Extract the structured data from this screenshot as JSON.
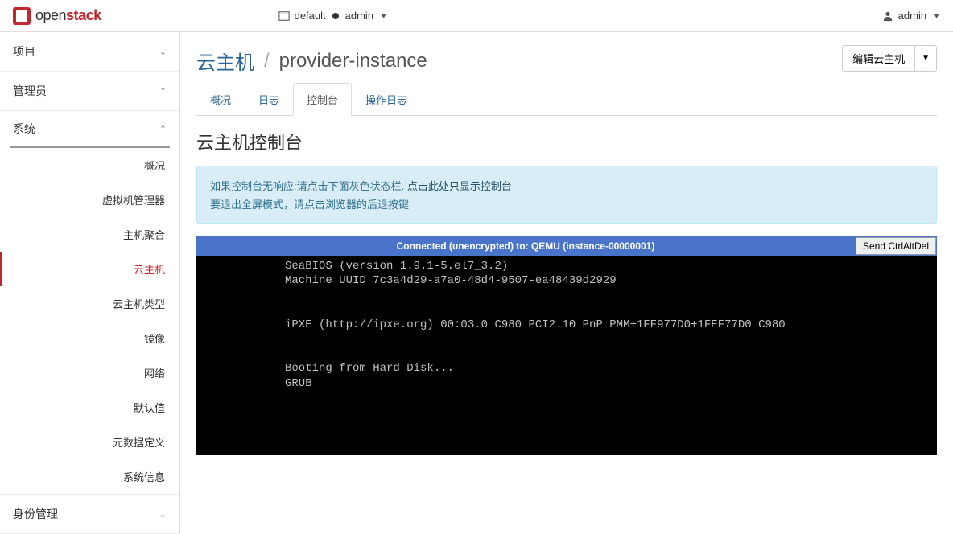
{
  "brand": {
    "name_plain": "open",
    "name_bold": "stack"
  },
  "topbar": {
    "domain_label": "default",
    "project_label": "admin",
    "user_label": "admin"
  },
  "sidebar": {
    "project_label": "项目",
    "admin_label": "管理员",
    "system_label": "系统",
    "identity_label": "身份管理",
    "system_items": {
      "overview": "概况",
      "hypervisors": "虚拟机管理器",
      "host_aggregates": "主机聚合",
      "instances": "云主机",
      "flavors": "云主机类型",
      "images": "镜像",
      "networks": "网络",
      "defaults": "默认值",
      "metadata": "元数据定义",
      "sysinfo": "系统信息"
    }
  },
  "breadcrumb": {
    "parent": "云主机",
    "current": "provider-instance"
  },
  "actions": {
    "edit": "编辑云主机"
  },
  "tabs": {
    "overview": "概况",
    "log": "日志",
    "console": "控制台",
    "actionlog": "操作日志"
  },
  "page": {
    "title": "云主机控制台",
    "info_line1_prefix": "如果控制台无响应:请点击下面灰色状态栏.",
    "info_link": "点击此处只显示控制台",
    "info_line2": "要退出全屏模式，请点击浏览器的后退按键"
  },
  "console": {
    "status": "Connected (unencrypted) to: QEMU (instance-00000001)",
    "send_button": "Send CtrlAltDel",
    "output": "SeaBIOS (version 1.9.1-5.el7_3.2)\nMachine UUID 7c3a4d29-a7a0-48d4-9507-ea48439d2929\n\n\niPXE (http://ipxe.org) 00:03.0 C980 PCI2.10 PnP PMM+1FF977D0+1FEF77D0 C980\n\n\nBooting from Hard Disk...\nGRUB"
  }
}
